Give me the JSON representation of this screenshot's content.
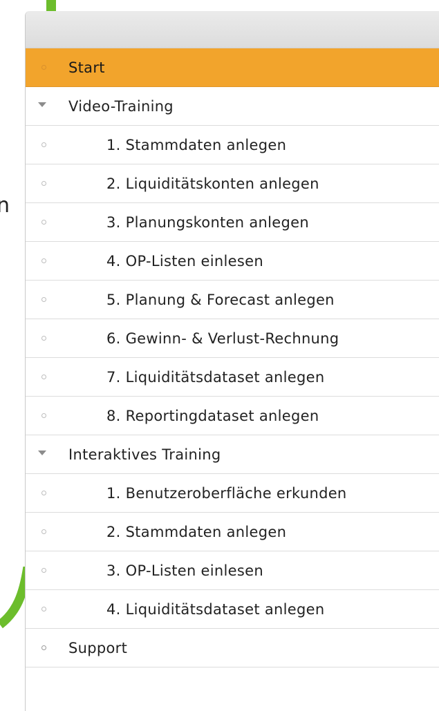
{
  "colors": {
    "accent_active": "#f2a42c",
    "brand_green": "#6cbd2c"
  },
  "side_text": "n",
  "nav": {
    "items": [
      {
        "label": "Start",
        "type": "page",
        "active": true
      },
      {
        "label": "Video-Training",
        "type": "group",
        "expanded": true
      },
      {
        "label": "1. Stammdaten anlegen",
        "type": "child"
      },
      {
        "label": "2. Liquiditätskonten anlegen",
        "type": "child"
      },
      {
        "label": "3. Planungskonten anlegen",
        "type": "child"
      },
      {
        "label": "4. OP-Listen einlesen",
        "type": "child"
      },
      {
        "label": "5. Planung & Forecast anlegen",
        "type": "child"
      },
      {
        "label": "6. Gewinn- & Verlust-Rechnung",
        "type": "child"
      },
      {
        "label": "7. Liquiditätsdataset anlegen",
        "type": "child"
      },
      {
        "label": "8. Reportingdataset anlegen",
        "type": "child"
      },
      {
        "label": "Interaktives Training",
        "type": "group",
        "expanded": true
      },
      {
        "label": "1. Benutzeroberfläche erkunden",
        "type": "child"
      },
      {
        "label": "2. Stammdaten anlegen",
        "type": "child"
      },
      {
        "label": "3. OP-Listen einlesen",
        "type": "child"
      },
      {
        "label": "4. Liquiditätsdataset anlegen",
        "type": "child"
      },
      {
        "label": "Support",
        "type": "page"
      }
    ]
  }
}
